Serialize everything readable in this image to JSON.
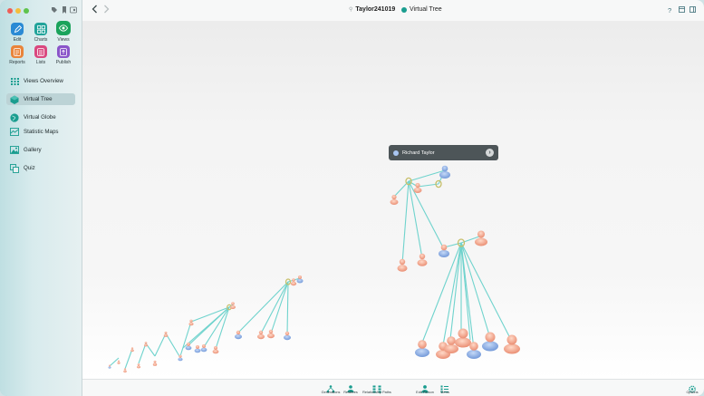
{
  "window": {
    "document_name": "Taylor241019",
    "view_name": "Virtual Tree"
  },
  "toolbar_tools": [
    {
      "label": "Edit",
      "icon": "pencil-icon",
      "color": "#2a8ad4"
    },
    {
      "label": "Charts",
      "icon": "charts-icon",
      "color": "#21a39a"
    },
    {
      "label": "Views",
      "icon": "eye-icon",
      "color": "#1aa35b"
    },
    {
      "label": "Reports",
      "icon": "reports-icon",
      "color": "#e9843a"
    },
    {
      "label": "Lists",
      "icon": "lists-icon",
      "color": "#d9487f"
    },
    {
      "label": "Publish",
      "icon": "publish-icon",
      "color": "#8a55c9"
    }
  ],
  "sidebar": {
    "items": [
      {
        "label": "Views Overview",
        "icon": "grid-icon",
        "selected": false
      },
      {
        "label": "Virtual Tree",
        "icon": "cube-icon",
        "selected": true
      },
      {
        "label": "Virtual Globe",
        "icon": "globe-icon",
        "selected": false
      },
      {
        "label": "Statistic Maps",
        "icon": "map-icon",
        "selected": false
      },
      {
        "label": "Gallery",
        "icon": "gallery-icon",
        "selected": false
      },
      {
        "label": "Quiz",
        "icon": "quiz-icon",
        "selected": false
      }
    ]
  },
  "tooltip": {
    "person_name": "Richard Taylor"
  },
  "bottom_bar": {
    "left_group": [
      {
        "label": "Generations",
        "icon": "generations-icon"
      },
      {
        "label": "Relatives",
        "icon": "relatives-icon"
      },
      {
        "label": "Relationship Paths",
        "icon": "relationship-paths-icon"
      }
    ],
    "right_group": [
      {
        "label": "Edit Person",
        "icon": "person-icon"
      },
      {
        "label": "Views",
        "icon": "views-list-icon"
      }
    ],
    "options": {
      "label": "Options",
      "icon": "gear-icon"
    }
  },
  "colors": {
    "accent": "#1a9d8f",
    "line": "#6fd3cd",
    "male": "#7fa6dd",
    "female": "#f0a98c",
    "ring": "#c7bf6a"
  }
}
